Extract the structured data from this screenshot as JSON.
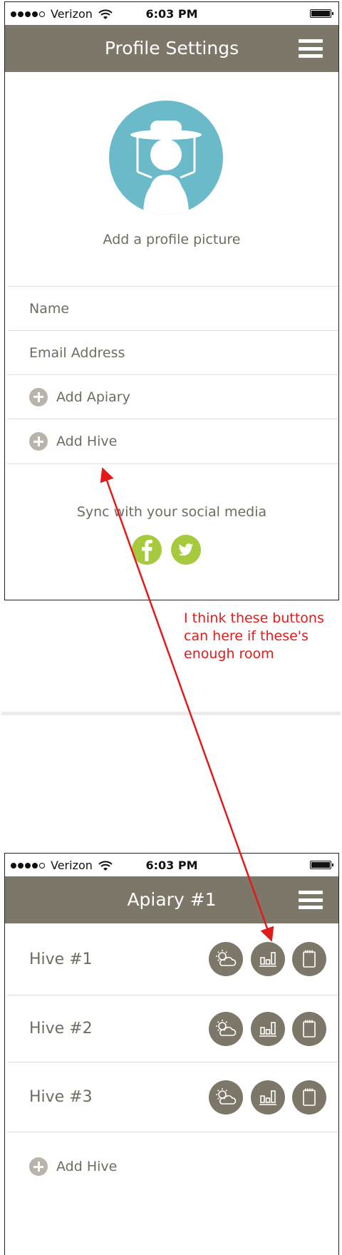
{
  "screen1": {
    "status": {
      "carrier": "Verizon",
      "time": "6:03 PM"
    },
    "nav": {
      "title": "Profile Settings",
      "menu_icon": "hamburger-menu-icon"
    },
    "avatar": {
      "icon": "beekeeper-avatar-icon",
      "label": "Add a profile picture"
    },
    "fields": {
      "name_placeholder": "Name",
      "email_placeholder": "Email Address"
    },
    "actions": {
      "add_apiary": "Add Apiary",
      "add_hive": "Add Hive"
    },
    "social": {
      "label": "Sync with your social media",
      "icons": [
        "facebook-icon",
        "twitter-icon"
      ]
    }
  },
  "annotation": {
    "text": "I think these buttons can here if these's enough room",
    "color": "#e41a1a"
  },
  "screen2": {
    "status": {
      "carrier": "Verizon",
      "time": "6:03 PM"
    },
    "nav": {
      "title": "Apiary #1",
      "menu_icon": "hamburger-menu-icon"
    },
    "hives": [
      {
        "name": "Hive #1"
      },
      {
        "name": "Hive #2"
      },
      {
        "name": "Hive #3"
      }
    ],
    "hive_action_icons": [
      "weather-icon",
      "chart-icon",
      "notes-icon"
    ],
    "add_hive": "Add Hive"
  },
  "colors": {
    "nav_bar": "#7c7769",
    "avatar_bg": "#6bbac9",
    "social_green": "#a6c93e",
    "plus_grey": "#b8b4ab",
    "text_grey": "#6f6b60"
  }
}
